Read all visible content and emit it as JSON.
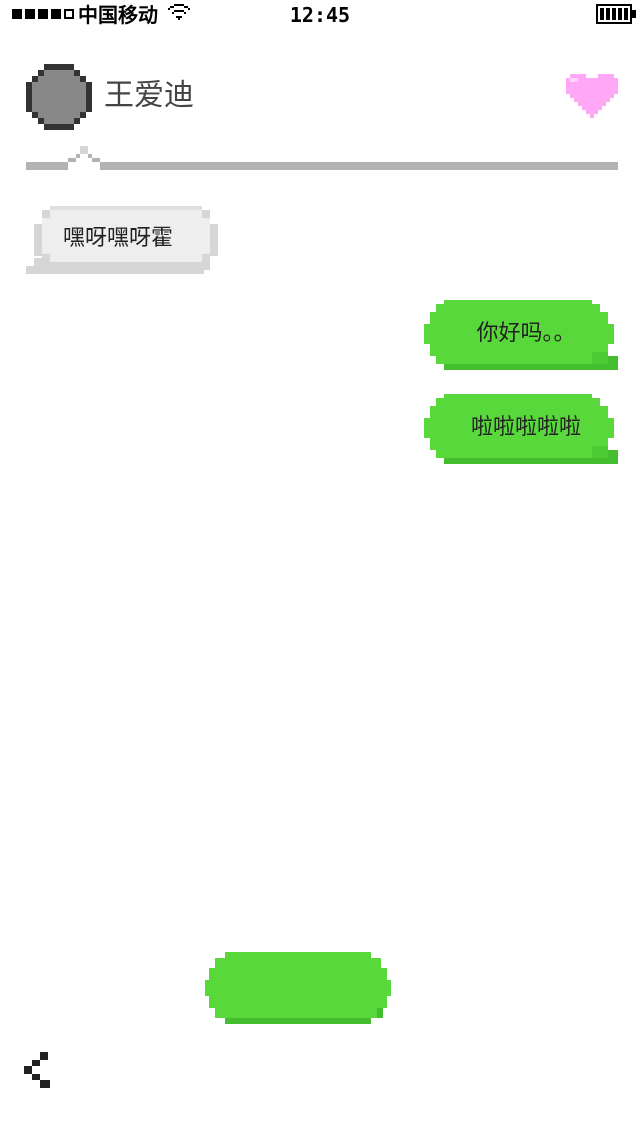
{
  "status_bar": {
    "signal_bars": 4,
    "signal_bars_total": 5,
    "carrier": "中国移动",
    "time": "12:45",
    "wifi_icon": "wifi-icon",
    "battery_icon": "battery-icon"
  },
  "header": {
    "avatar_icon": "avatar-icon",
    "contact_name": "王爱迪",
    "favorite_icon": "heart-icon"
  },
  "messages": [
    {
      "side": "incoming",
      "text": "嘿呀嘿呀霍"
    },
    {
      "side": "outgoing",
      "text": "你好吗。。"
    },
    {
      "side": "outgoing",
      "text": "啦啦啦啦啦"
    }
  ],
  "colors": {
    "incoming_bubble": "#eeeeee",
    "incoming_border": "#d6d6d6",
    "outgoing_bubble": "#58d83a",
    "outgoing_shadow": "#44be2e",
    "heart": "#ffa6f4",
    "avatar": "#888888",
    "divider": "#b3b3b3"
  },
  "footer": {
    "record_button_icon": "record-button",
    "back_icon": "back-chevron-icon"
  }
}
